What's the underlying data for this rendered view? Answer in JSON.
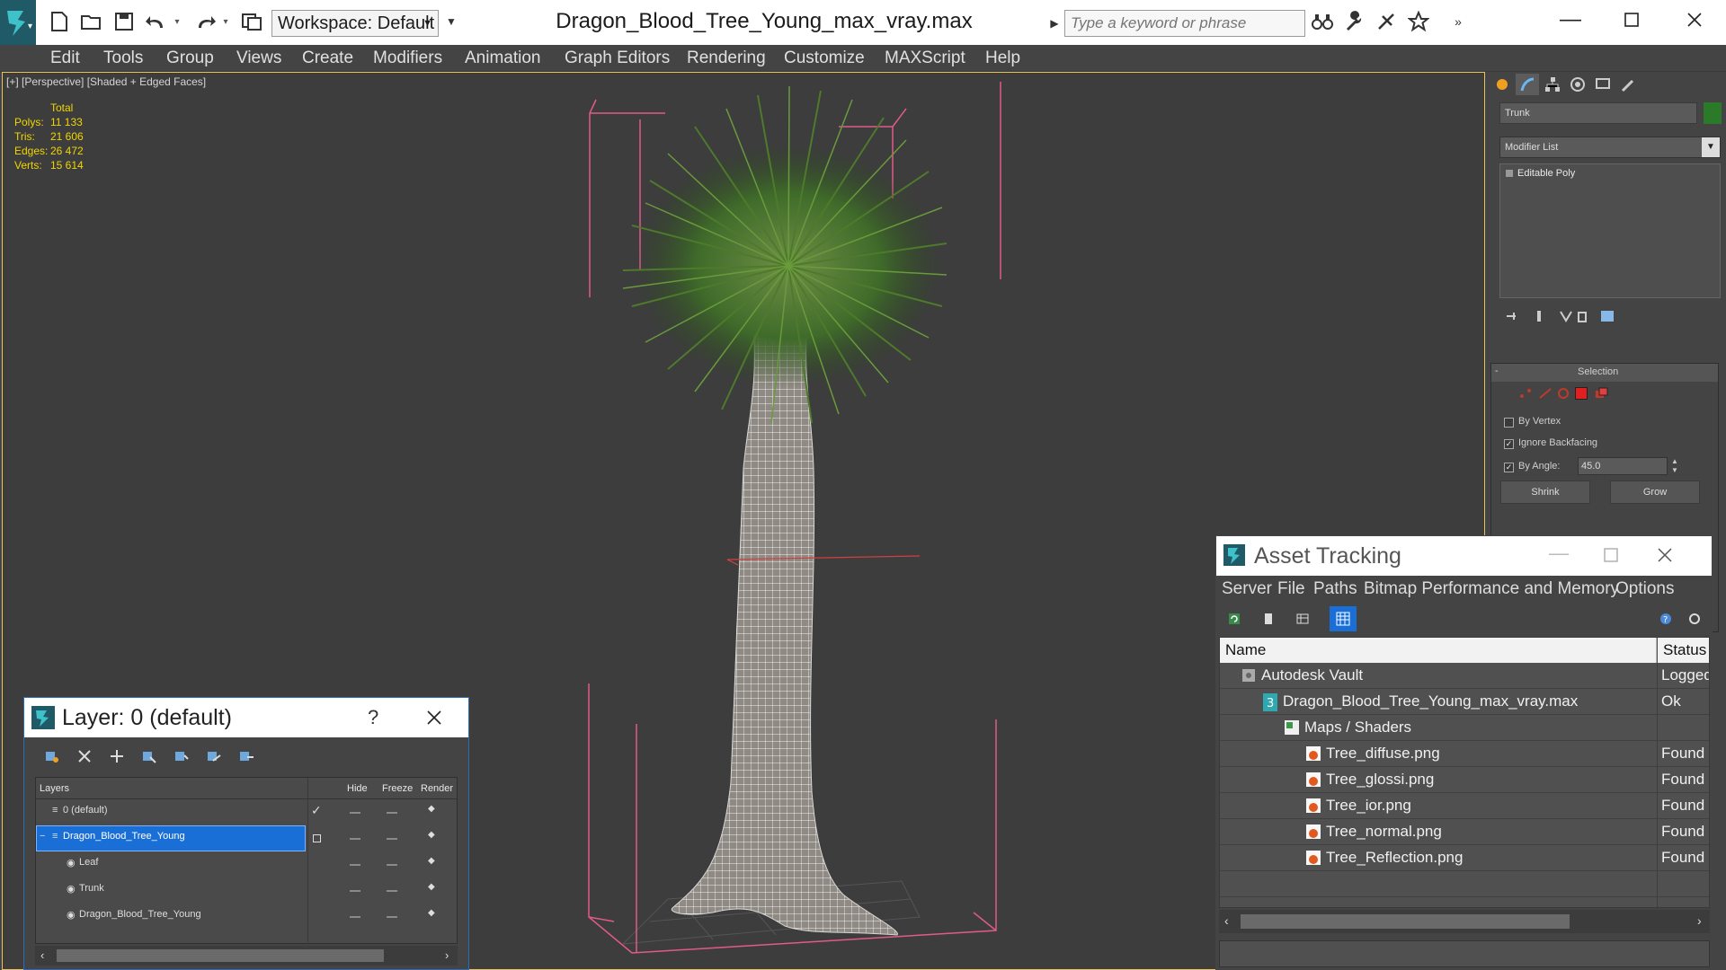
{
  "title_bar": {
    "workspace": "Workspace: Default",
    "document_title": "Dragon_Blood_Tree_Young_max_vray.max",
    "search_placeholder": "Type a keyword or phrase"
  },
  "menu": [
    "Edit",
    "Tools",
    "Group",
    "Views",
    "Create",
    "Modifiers",
    "Animation",
    "Graph Editors",
    "Rendering",
    "Customize",
    "MAXScript",
    "Help"
  ],
  "viewport": {
    "label": "[+] [Perspective] [Shaded + Edged Faces]",
    "stats_header": "Total",
    "stats": [
      {
        "label": "Polys:",
        "value": "11 133"
      },
      {
        "label": "Tris:",
        "value": "21 606"
      },
      {
        "label": "Edges:",
        "value": "26 472"
      },
      {
        "label": "Verts:",
        "value": "15 614"
      }
    ]
  },
  "command_panel": {
    "object_name": "Trunk",
    "modifier_list": "Modifier List",
    "stack_item": "Editable Poly",
    "rollout_title": "Selection",
    "options": [
      {
        "label": "By Vertex",
        "checked": false
      },
      {
        "label": "Ignore Backfacing",
        "checked": true
      },
      {
        "label": "By Angle:",
        "checked": true
      }
    ],
    "angle_value": "45.0",
    "shrink_label": "Shrink",
    "grow_label": "Grow"
  },
  "layer_dialog": {
    "title": "Layer: 0 (default)",
    "help": "?",
    "columns": [
      "Layers",
      "Hide",
      "Freeze",
      "Render"
    ],
    "rows": [
      {
        "name": "0 (default)",
        "indent": 1,
        "selected": false,
        "current": true
      },
      {
        "name": "Dragon_Blood_Tree_Young",
        "indent": 1,
        "selected": true,
        "current": false
      },
      {
        "name": "Leaf",
        "indent": 2,
        "selected": false,
        "current": false
      },
      {
        "name": "Trunk",
        "indent": 2,
        "selected": false,
        "current": false
      },
      {
        "name": "Dragon_Blood_Tree_Young",
        "indent": 2,
        "selected": false,
        "current": false
      }
    ]
  },
  "asset_tracking": {
    "title": "Asset Tracking",
    "menu": [
      "Server",
      "File",
      "Paths",
      "Bitmap Performance and Memory",
      "Options"
    ],
    "columns": [
      "Name",
      "Status"
    ],
    "rows": [
      {
        "name": "Autodesk Vault",
        "status": "Logged",
        "indent": 1,
        "icon": "vault-icon"
      },
      {
        "name": "Dragon_Blood_Tree_Young_max_vray.max",
        "status": "Ok",
        "indent": 2,
        "icon": "max-file-icon"
      },
      {
        "name": "Maps / Shaders",
        "status": "",
        "indent": 3,
        "icon": "maps-folder-icon"
      },
      {
        "name": "Tree_diffuse.png",
        "status": "Found",
        "indent": 4,
        "icon": "png-icon"
      },
      {
        "name": "Tree_glossi.png",
        "status": "Found",
        "indent": 4,
        "icon": "png-icon"
      },
      {
        "name": "Tree_ior.png",
        "status": "Found",
        "indent": 4,
        "icon": "png-icon"
      },
      {
        "name": "Tree_normal.png",
        "status": "Found",
        "indent": 4,
        "icon": "png-icon"
      },
      {
        "name": "Tree_Reflection.png",
        "status": "Found",
        "indent": 4,
        "icon": "png-icon"
      }
    ]
  },
  "colors": {
    "accent": "#2b6bbd",
    "selection": "#1a6fd6",
    "viewport_bg": "#3d3d3d",
    "stats_text": "#f0d500",
    "bbox": "#e05b8a"
  }
}
